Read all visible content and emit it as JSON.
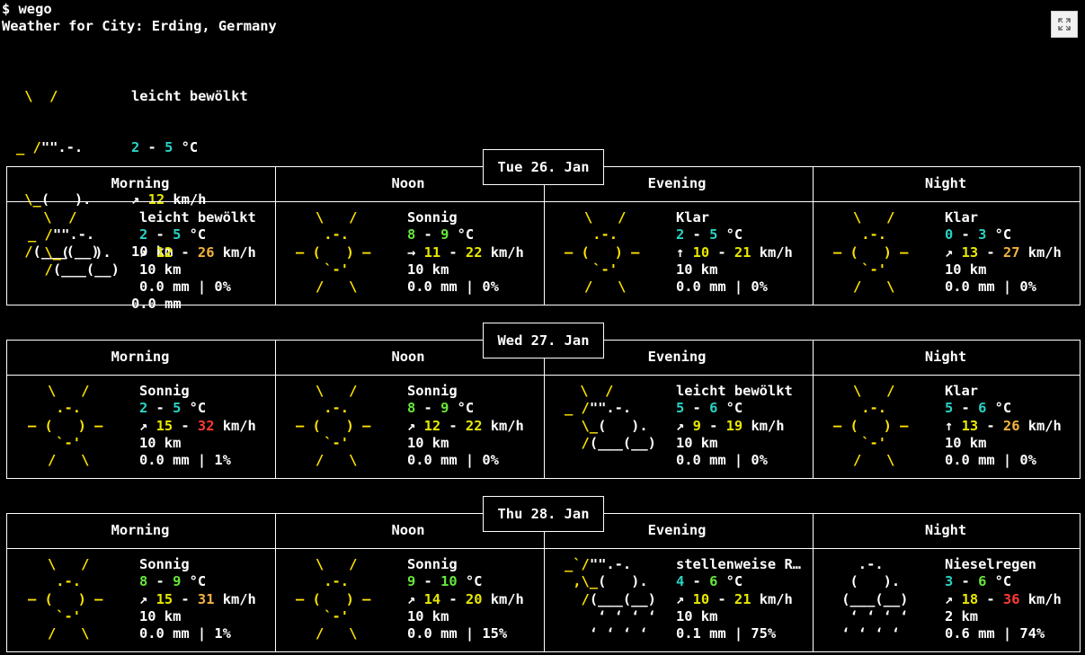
{
  "terminal": {
    "prompt": "$ wego",
    "title": "Weather for City: Erding, Germany"
  },
  "current": {
    "art": [
      " \\  /",
      "_ /\"\".-.",
      " \\_(   ).",
      " /(___(__)"
    ],
    "desc": "leicht bewölkt",
    "temp_low": "2",
    "temp_high": "5",
    "temp_unit": " °C",
    "wind_arrow": "↗",
    "wind": "12",
    "wind_unit": " km/h",
    "vis": "10 km",
    "precip": "0.0 mm"
  },
  "days": [
    {
      "date": "Tue 26. Jan",
      "periods": [
        {
          "name": "Morning",
          "type": "cloud",
          "desc": "leicht bewölkt",
          "t1": "2",
          "t2": "5",
          "c1": "c",
          "c2": "c",
          "dir": "↗",
          "w1": "12",
          "w2": "26",
          "wc1": "ya",
          "wc2": "o",
          "vis": "10 km",
          "prec": "0.0 mm | 0%"
        },
        {
          "name": "Noon",
          "type": "sun",
          "desc": "Sonnig",
          "t1": "8",
          "t2": "9",
          "c1": "g",
          "c2": "g",
          "dir": "→",
          "w1": "11",
          "w2": "22",
          "wc1": "ya",
          "wc2": "ya",
          "vis": "10 km",
          "prec": "0.0 mm | 0%"
        },
        {
          "name": "Evening",
          "type": "sun",
          "desc": "Klar",
          "t1": "2",
          "t2": "5",
          "c1": "c",
          "c2": "c",
          "dir": "↑",
          "w1": "10",
          "w2": "21",
          "wc1": "ya",
          "wc2": "ya",
          "vis": "10 km",
          "prec": "0.0 mm | 0%"
        },
        {
          "name": "Night",
          "type": "sun",
          "desc": "Klar",
          "t1": "0",
          "t2": "3",
          "c1": "c",
          "c2": "c",
          "dir": "↗",
          "w1": "13",
          "w2": "27",
          "wc1": "ya",
          "wc2": "o",
          "vis": "10 km",
          "prec": "0.0 mm | 0%"
        }
      ]
    },
    {
      "date": "Wed 27. Jan",
      "periods": [
        {
          "name": "Morning",
          "type": "sun",
          "desc": "Sonnig",
          "t1": "2",
          "t2": "5",
          "c1": "c",
          "c2": "c",
          "dir": "↗",
          "w1": "15",
          "w2": "32",
          "wc1": "ya",
          "wc2": "r",
          "vis": "10 km",
          "prec": "0.0 mm | 1%"
        },
        {
          "name": "Noon",
          "type": "sun",
          "desc": "Sonnig",
          "t1": "8",
          "t2": "9",
          "c1": "g",
          "c2": "g",
          "dir": "↗",
          "w1": "12",
          "w2": "22",
          "wc1": "ya",
          "wc2": "ya",
          "vis": "10 km",
          "prec": "0.0 mm | 0%"
        },
        {
          "name": "Evening",
          "type": "cloud",
          "desc": "leicht bewölkt",
          "t1": "5",
          "t2": "6",
          "c1": "c",
          "c2": "c",
          "dir": "↗",
          "w1": "9",
          "w2": "19",
          "wc1": "ya",
          "wc2": "ya",
          "vis": "10 km",
          "prec": "0.0 mm | 0%"
        },
        {
          "name": "Night",
          "type": "sun",
          "desc": "Klar",
          "t1": "5",
          "t2": "6",
          "c1": "c",
          "c2": "c",
          "dir": "↑",
          "w1": "13",
          "w2": "26",
          "wc1": "ya",
          "wc2": "o",
          "vis": "10 km",
          "prec": "0.0 mm | 0%"
        }
      ]
    },
    {
      "date": "Thu 28. Jan",
      "periods": [
        {
          "name": "Morning",
          "type": "sun",
          "desc": "Sonnig",
          "t1": "8",
          "t2": "9",
          "c1": "g",
          "c2": "g",
          "dir": "↗",
          "w1": "15",
          "w2": "31",
          "wc1": "ya",
          "wc2": "o",
          "vis": "10 km",
          "prec": "0.0 mm | 1%"
        },
        {
          "name": "Noon",
          "type": "sun",
          "desc": "Sonnig",
          "t1": "9",
          "t2": "10",
          "c1": "g",
          "c2": "g",
          "dir": "↗",
          "w1": "14",
          "w2": "20",
          "wc1": "ya",
          "wc2": "ya",
          "vis": "10 km",
          "prec": "0.0 mm | 15%"
        },
        {
          "name": "Evening",
          "type": "rain",
          "desc": "stellenweise R…",
          "t1": "4",
          "t2": "6",
          "c1": "c",
          "c2": "g",
          "dir": "↗",
          "w1": "10",
          "w2": "21",
          "wc1": "ya",
          "wc2": "ya",
          "vis": "10 km",
          "prec": "0.1 mm | 75%"
        },
        {
          "name": "Night",
          "type": "drizzle",
          "desc": "Nieselregen",
          "t1": "3",
          "t2": "6",
          "c1": "c",
          "c2": "g",
          "dir": "↗",
          "w1": "18",
          "w2": "36",
          "wc1": "ya",
          "wc2": "r",
          "vis": "2 km",
          "prec": "0.6 mm | 74%"
        }
      ]
    }
  ],
  "icons": {
    "sun": [
      "\\   /",
      " .-.",
      "― (   ) ―",
      " `-'",
      "/   \\"
    ],
    "cloud": [
      " \\  /",
      "_ /\"\".-.",
      "  \\_(   ).",
      "  /(___(__)",
      ""
    ],
    "rain": [
      "_`/\"\".-.",
      " ,\\_(   ).",
      "  /(___(__)",
      "    ‘ ‘ ‘ ‘",
      "   ‘ ‘ ‘ ‘"
    ],
    "drizzle": [
      "  .-.",
      " (   ).",
      "(___(__)",
      " ‘ ‘ ‘ ‘",
      "‘ ‘ ‘ ‘"
    ]
  },
  "expand_icon": "expand-icon"
}
